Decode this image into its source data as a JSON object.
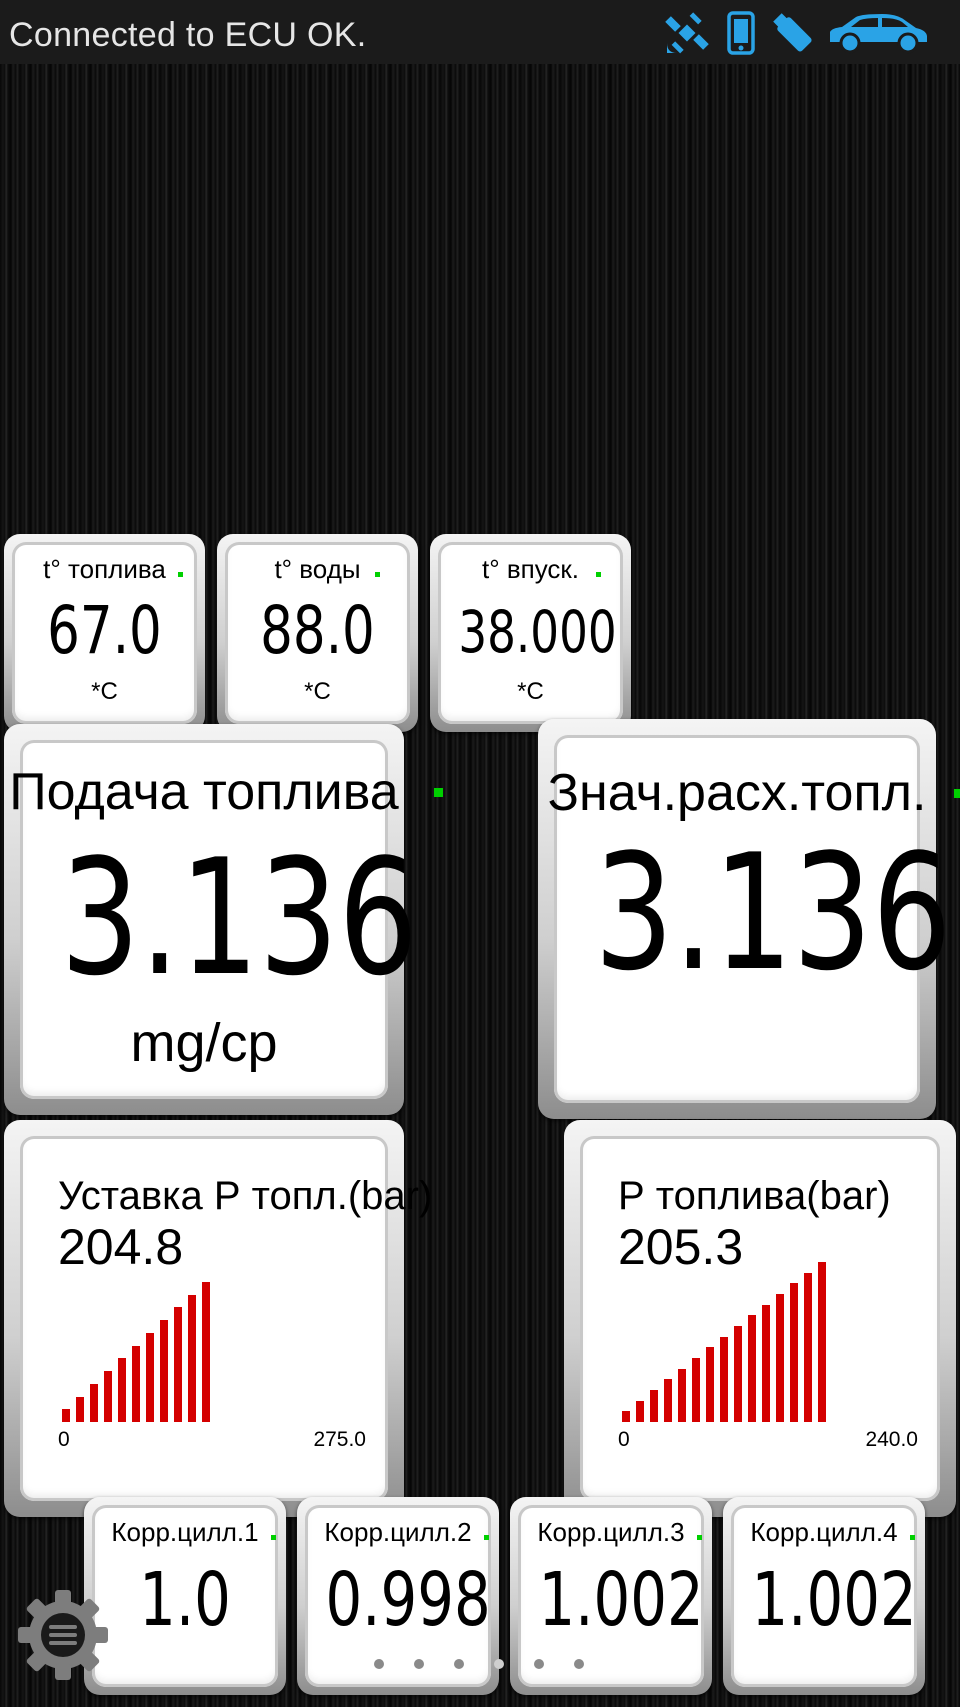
{
  "status_bar": {
    "connection_text": "Connected to ECU OK.",
    "icons": [
      "satellite-icon",
      "phone-icon",
      "usb-icon",
      "car-icon"
    ],
    "icon_color": "#2aa3e6"
  },
  "small_gauges": [
    {
      "label": "t° топлива",
      "value": "67.0",
      "unit": "*C"
    },
    {
      "label": "t° воды",
      "value": "88.0",
      "unit": "*C"
    },
    {
      "label": "t° впуск.",
      "value": "38.000",
      "unit": "*C"
    }
  ],
  "big_gauges": [
    {
      "label": "Подача топлива",
      "value": "3.136",
      "unit": "mg/cp"
    },
    {
      "label": "Знач.расх.топл.",
      "value": "3.136",
      "unit": ""
    }
  ],
  "bar_gauges": [
    {
      "label": "Уставка Р топл.(bar)",
      "value": "204.8",
      "min_label": "0",
      "max_label": "275.0",
      "fill_fraction": 0.745,
      "bar_color": "#d40000"
    },
    {
      "label": "Р топлива(bar)",
      "value": "205.3",
      "min_label": "0",
      "max_label": "240.0",
      "fill_fraction": 0.855,
      "bar_color": "#d40000"
    }
  ],
  "cyl_gauges": [
    {
      "label": "Корр.цилл.1",
      "value": "1.0"
    },
    {
      "label": "Корр.цилл.2",
      "value": "0.998"
    },
    {
      "label": "Корр.цилл.3",
      "value": "1.002"
    },
    {
      "label": "Корр.цилл.4",
      "value": "1.002"
    }
  ],
  "indicator_color": "#00d000",
  "pager": {
    "pages": 6,
    "current": 4
  },
  "menu_button": {
    "icon": "gear-menu-icon"
  }
}
